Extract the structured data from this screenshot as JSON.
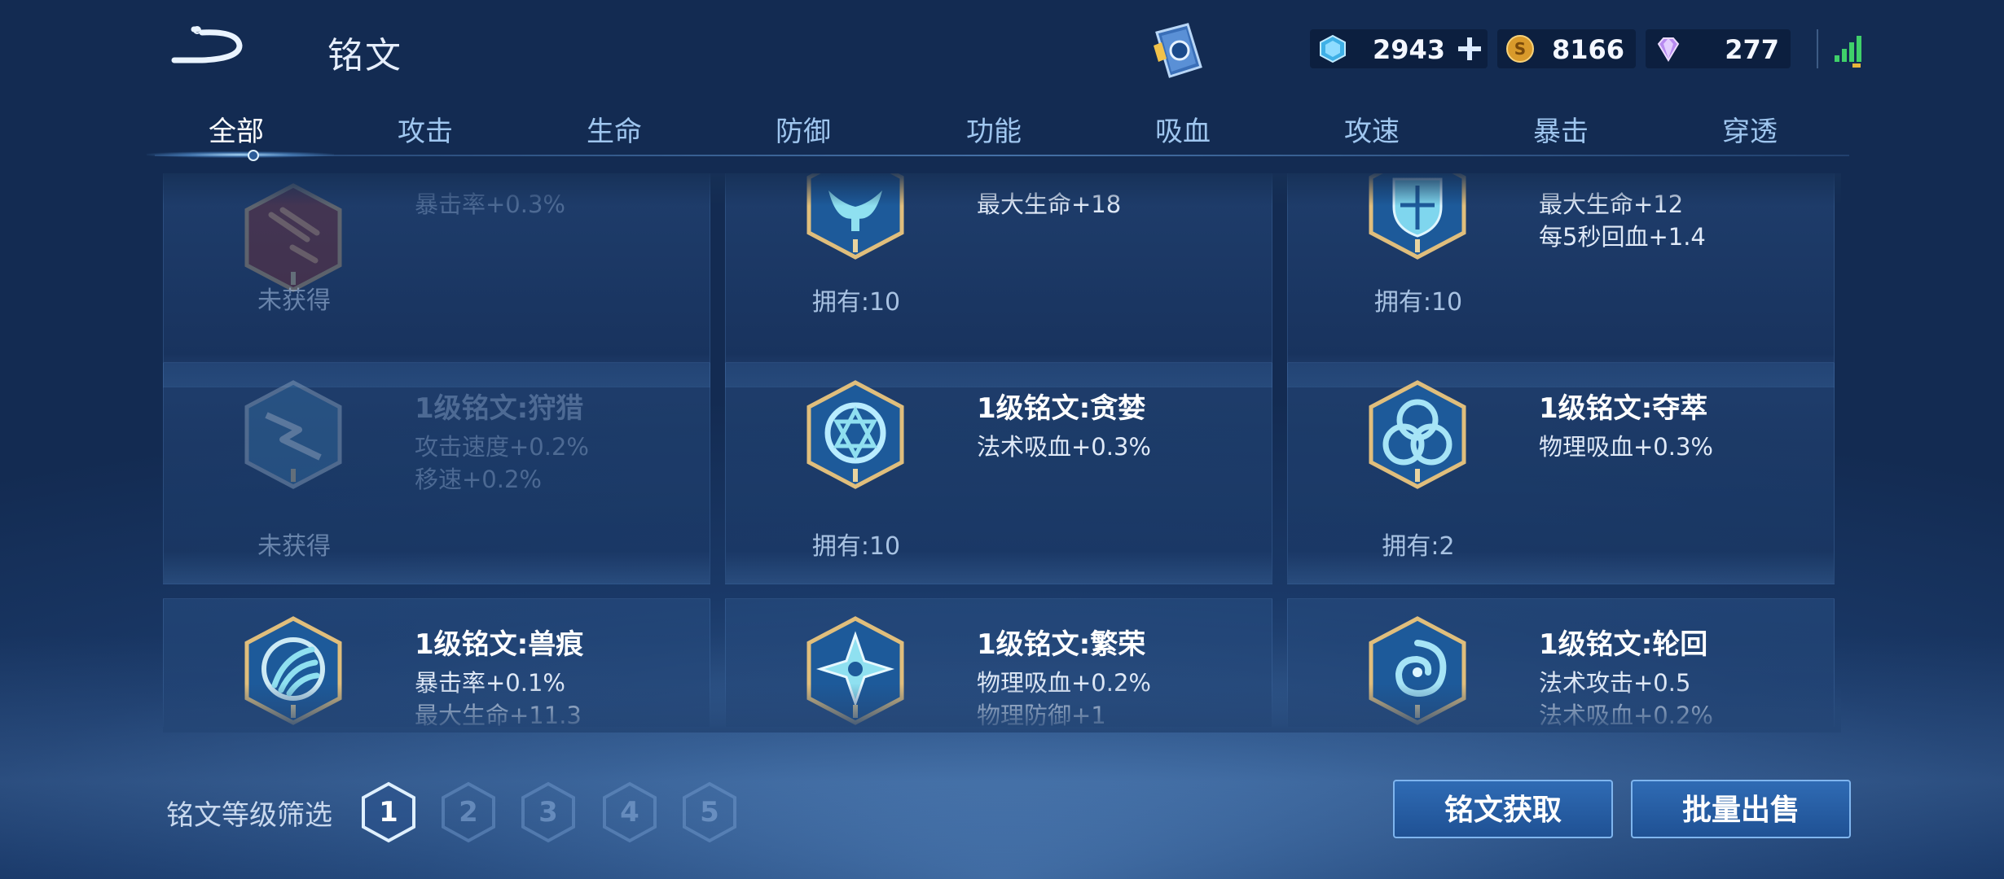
{
  "header": {
    "title": "铭文",
    "currencies": [
      {
        "icon": "diamond-coupon-icon",
        "value": "2943"
      },
      {
        "icon": "gold-coin-icon",
        "value": "8166"
      },
      {
        "icon": "gem-icon",
        "value": "277"
      }
    ]
  },
  "tabs": [
    {
      "label": "全部",
      "active": true
    },
    {
      "label": "攻击"
    },
    {
      "label": "生命"
    },
    {
      "label": "防御"
    },
    {
      "label": "功能"
    },
    {
      "label": "吸血"
    },
    {
      "label": "攻速"
    },
    {
      "label": "暴击"
    },
    {
      "label": "穿透"
    }
  ],
  "cards": [
    {
      "name": "",
      "stat1": "暴击率+0.3%",
      "stat2": "",
      "owned": "未获得",
      "locked": true,
      "icon": "red-claw-rune-icon"
    },
    {
      "name": "",
      "stat1": "最大生命+18",
      "stat2": "",
      "owned": "拥有:10",
      "locked": false,
      "icon": "whale-tail-rune-icon"
    },
    {
      "name": "",
      "stat1": "最大生命+12",
      "stat2": "每5秒回血+1.4",
      "owned": "拥有:10",
      "locked": false,
      "icon": "shield-crest-rune-icon"
    },
    {
      "name": "1级铭文:狩猎",
      "stat1": "攻击速度+0.2%",
      "stat2": "移速+0.2%",
      "owned": "未获得",
      "locked": true,
      "icon": "lightning-rune-icon"
    },
    {
      "name": "1级铭文:贪婪",
      "stat1": "法术吸血+0.3%",
      "stat2": "",
      "owned": "拥有:10",
      "locked": false,
      "icon": "star-ring-rune-icon"
    },
    {
      "name": "1级铭文:夺萃",
      "stat1": "物理吸血+0.3%",
      "stat2": "",
      "owned": "拥有:2",
      "locked": false,
      "icon": "triquetra-rune-icon"
    },
    {
      "name": "1级铭文:兽痕",
      "stat1": "暴击率+0.1%",
      "stat2": "最大生命+11.3",
      "owned": "",
      "locked": false,
      "icon": "claw-mark-rune-icon"
    },
    {
      "name": "1级铭文:繁荣",
      "stat1": "物理吸血+0.2%",
      "stat2": "物理防御+1",
      "owned": "",
      "locked": false,
      "icon": "cross-star-rune-icon"
    },
    {
      "name": "1级铭文:轮回",
      "stat1": "法术攻击+0.5",
      "stat2": "法术吸血+0.2%",
      "owned": "",
      "locked": false,
      "icon": "swirl-rune-icon"
    }
  ],
  "footer": {
    "filter_label": "铭文等级筛选",
    "levels": [
      "1",
      "2",
      "3",
      "4",
      "5"
    ],
    "selected_level": "1",
    "get_button": "铭文获取",
    "sell_button": "批量出售"
  }
}
